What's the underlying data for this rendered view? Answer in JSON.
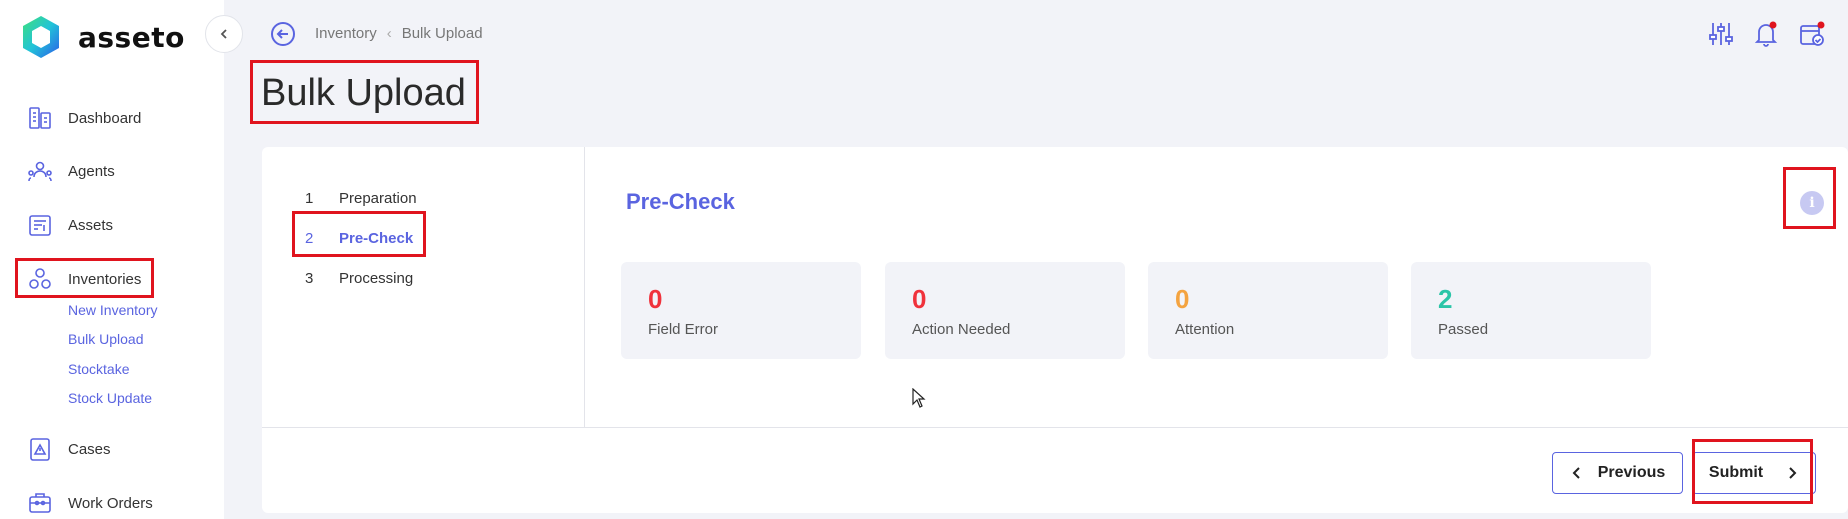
{
  "app": {
    "name": "asseto"
  },
  "sidebar": {
    "items": [
      {
        "label": "Dashboard",
        "icon": "dashboard-icon"
      },
      {
        "label": "Agents",
        "icon": "agents-icon"
      },
      {
        "label": "Assets",
        "icon": "assets-icon"
      },
      {
        "label": "Inventories",
        "icon": "inventories-icon"
      },
      {
        "label": "Cases",
        "icon": "cases-icon"
      },
      {
        "label": "Work Orders",
        "icon": "work-orders-icon"
      }
    ],
    "sub_items": [
      "New Inventory",
      "Bulk Upload",
      "Stocktake",
      "Stock Update"
    ]
  },
  "breadcrumb": [
    "Inventory",
    "Bulk Upload"
  ],
  "page": {
    "title": "Bulk Upload"
  },
  "steps": [
    {
      "num": "1",
      "label": "Preparation"
    },
    {
      "num": "2",
      "label": "Pre-Check"
    },
    {
      "num": "3",
      "label": "Processing"
    }
  ],
  "section": {
    "title": "Pre-Check",
    "info": "i"
  },
  "stats": [
    {
      "value": "0",
      "label": "Field Error",
      "color": "#f0323c"
    },
    {
      "value": "0",
      "label": "Action Needed",
      "color": "#f0323c"
    },
    {
      "value": "0",
      "label": "Attention",
      "color": "#f4a340"
    },
    {
      "value": "2",
      "label": "Passed",
      "color": "#2bc5a8"
    }
  ],
  "buttons": {
    "previous": "Previous",
    "submit": "Submit"
  },
  "colors": {
    "accent": "#5a64e0",
    "highlight": "#e0141e",
    "notification": "#e0141e"
  }
}
